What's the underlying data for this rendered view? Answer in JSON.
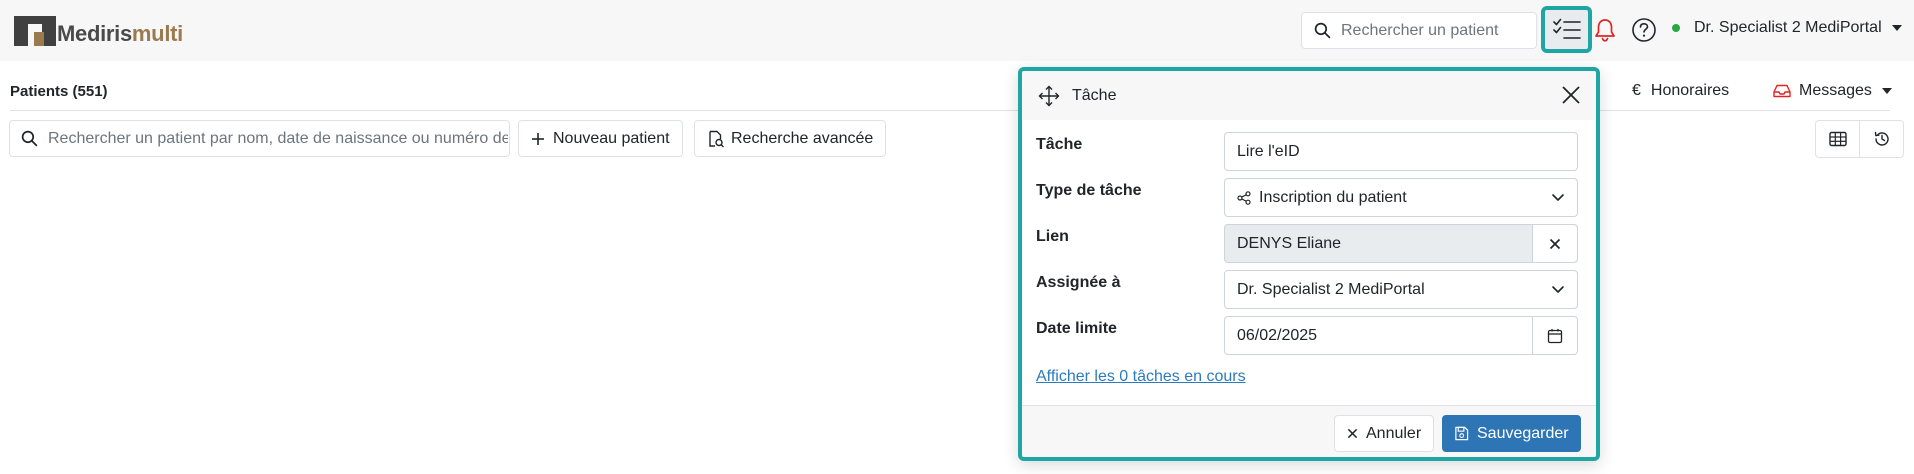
{
  "app": {
    "logo_text_a": "Mediris",
    "logo_text_b": "multi",
    "top_search_placeholder": "Rechercher un patient",
    "user_name": "Dr. Specialist 2 MediPortal"
  },
  "page": {
    "patients_title": "Patients (551)",
    "tab_honoraires": "Honoraires",
    "tab_messages": "Messages",
    "patient_search_placeholder": "Rechercher un patient par nom, date de naissance ou numéro de",
    "new_patient_label": "Nouveau patient",
    "advanced_search_label": "Recherche avancée"
  },
  "modal": {
    "title": "Tâche",
    "task_label": "Tâche",
    "task_value": "Lire l'eID",
    "type_label": "Type de tâche",
    "type_value": "Inscription du patient",
    "link_label": "Lien",
    "link_value": "DENYS Eliane",
    "assignee_label": "Assignée à",
    "assignee_value": "Dr. Specialist 2 MediPortal",
    "due_label": "Date limite",
    "due_value": "06/02/2025",
    "show_tasks_link": "Afficher les 0 tâches en cours",
    "cancel_label": "Annuler",
    "save_label": "Sauvegarder"
  },
  "colors": {
    "accent": "#1fa5a3",
    "primary": "#2e75b6",
    "logo_brown": "#9a7b4f",
    "bell_red": "#e02424",
    "status_green": "#28a745"
  }
}
